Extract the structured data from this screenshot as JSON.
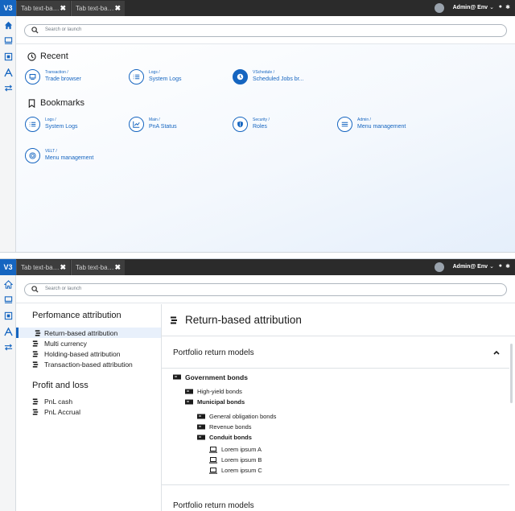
{
  "app": {
    "logo": "V3",
    "user": "Admin@ Env"
  },
  "tabs": [
    {
      "label": "Tab text-ba…"
    },
    {
      "label": "Tab text-ba…"
    }
  ],
  "search": {
    "placeholder": "Search or launch"
  },
  "sidebar_icons": [
    "home-icon",
    "monitor-icon",
    "grid-icon",
    "chart-a-icon",
    "swap-icon"
  ],
  "home": {
    "recent_title": "Recent",
    "bookmarks_title": "Bookmarks",
    "recent": [
      {
        "path": "Transaction /",
        "name": "Trade browser",
        "icon": "monitor-icon"
      },
      {
        "path": "Logs /",
        "name": "System Logs",
        "icon": "list-icon"
      },
      {
        "path": "VSchedule /",
        "name": "Scheduled Jobs br...",
        "icon": "clock-icon"
      }
    ],
    "bookmarks": [
      {
        "path": "Logs /",
        "name": "System Logs",
        "icon": "list-icon"
      },
      {
        "path": "Main /",
        "name": "PnA Status",
        "icon": "chart-icon"
      },
      {
        "path": "Security /",
        "name": "Roles",
        "icon": "shield-icon"
      },
      {
        "path": "Admin /",
        "name": "Menu management",
        "icon": "menu-icon"
      },
      {
        "path": "VELT /",
        "name": "Menu management",
        "icon": "target-icon"
      }
    ]
  },
  "attribution": {
    "nav": {
      "perf_title": "Perfomance attribution",
      "perf_items": [
        "Return-based attribution",
        "Multi currency",
        "Holding-based attribution",
        "Transaction-based attribution"
      ],
      "pnl_title": "Profit and loss",
      "pnl_items": [
        "PnL cash",
        "PnL Accrual"
      ]
    },
    "page_title": "Return-based attribution",
    "accordion1_title": "Portfolio return models",
    "accordion2_title": "Portfolio return models",
    "tree": {
      "root": "Government bonds",
      "high_yield": "High-yield bonds",
      "municipal": "Municipal bonds",
      "general": "General obligation bonds",
      "revenue": "Revenue bonds",
      "conduit": "Conduit bonds",
      "leaves": [
        "Lorem ipsum A",
        "Lorem ipsum B",
        "Lorem ipsum C"
      ]
    }
  },
  "colors": {
    "accent": "#1565c0",
    "topbar": "#2b2b2b",
    "active_bg": "#e8f0fb"
  }
}
